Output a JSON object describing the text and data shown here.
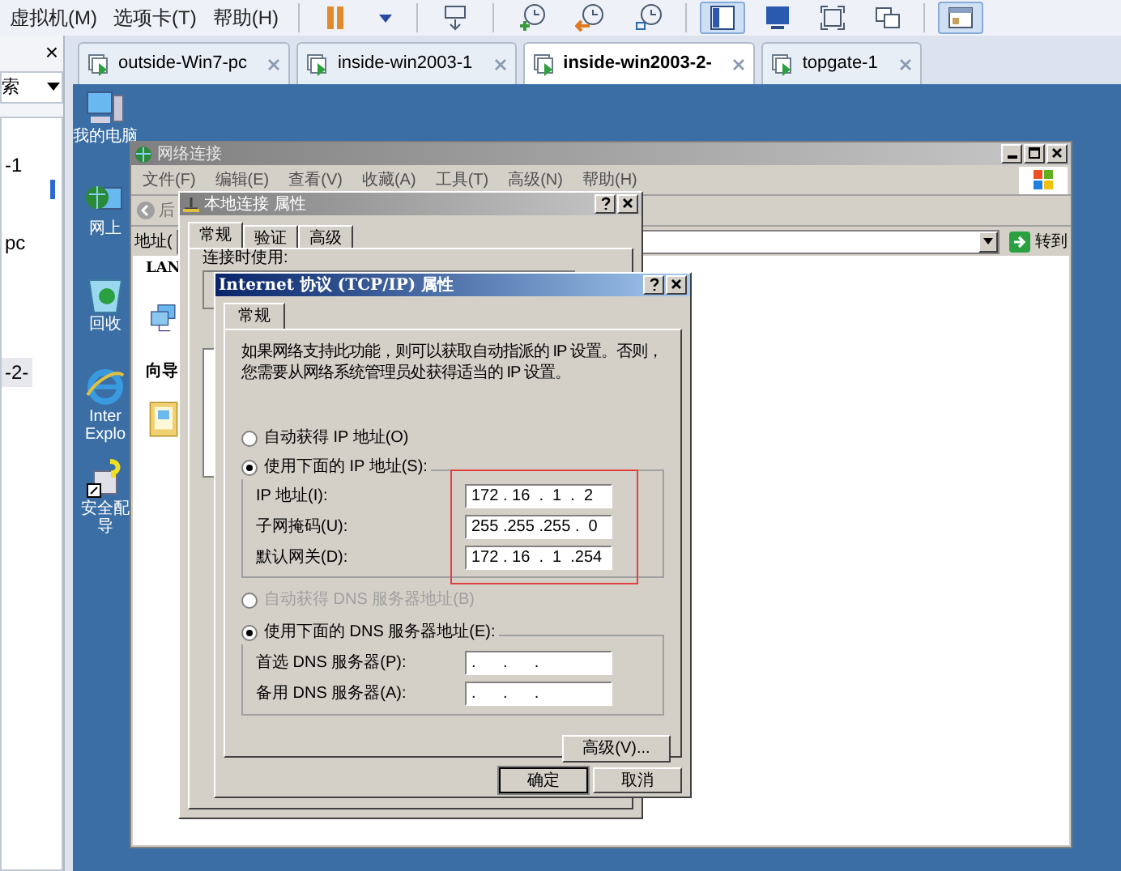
{
  "menubar": [
    "虚拟机(M)",
    "选项卡(T)",
    "帮助(H)"
  ],
  "toolbar": [
    {
      "kind": "separator"
    },
    {
      "kind": "pause",
      "selected": false
    },
    {
      "kind": "dropdown",
      "selected": false
    },
    {
      "kind": "separator"
    },
    {
      "kind": "sendkeys",
      "selected": false
    },
    {
      "kind": "separator"
    },
    {
      "kind": "snapshot",
      "selected": false
    },
    {
      "kind": "revert",
      "selected": false
    },
    {
      "kind": "manager",
      "selected": false
    },
    {
      "kind": "separator"
    },
    {
      "kind": "console",
      "selected": true
    },
    {
      "kind": "fullscreen",
      "selected": false
    },
    {
      "kind": "fit",
      "selected": false
    },
    {
      "kind": "unity",
      "selected": false
    },
    {
      "kind": "separator"
    },
    {
      "kind": "thumbnail",
      "selected": true
    }
  ],
  "library": {
    "close": "×",
    "search": "索",
    "items": [
      {
        "label": "-1",
        "selected": false
      },
      {
        "label": "pc",
        "selected": false
      },
      {
        "label": "-2-",
        "selected": true
      }
    ]
  },
  "vm_tabs": [
    {
      "label": "outside-Win7-pc",
      "selected": false
    },
    {
      "label": "inside-win2003-1",
      "selected": false
    },
    {
      "label": "inside-win2003-2-",
      "selected": true
    },
    {
      "label": "topgate-1",
      "selected": false
    }
  ],
  "desktop_icons": [
    {
      "kind": "computer",
      "lines": [
        "我的电脑"
      ]
    },
    {
      "kind": "network",
      "lines": [
        "网上"
      ]
    },
    {
      "kind": "recycle",
      "lines": [
        "回收"
      ]
    },
    {
      "kind": "browser",
      "lines": [
        "Inter",
        "Explo"
      ]
    },
    {
      "kind": "security",
      "lines": [
        "安全配",
        "导"
      ]
    }
  ],
  "network_window": {
    "title": "网络连接",
    "menu": [
      "文件(F)",
      "编辑(E)",
      "查看(V)",
      "收藏(A)",
      "工具(T)",
      "高级(N)",
      "帮助(H)"
    ],
    "back": "后",
    "address_label": "地址(",
    "go": "转到",
    "sections": [
      "LAN",
      "向导"
    ]
  },
  "local_dialog": {
    "title": "本地连接 属性",
    "tabs": [
      {
        "label": "常规",
        "selected": true
      },
      {
        "label": "验证",
        "selected": false
      },
      {
        "label": "高级",
        "selected": false
      }
    ],
    "connect_using": "连接时使用:"
  },
  "tcp_dialog": {
    "title": "Internet 协议 (TCP/IP) 属性",
    "tab": "常规",
    "intro": [
      "如果网络支持此功能，则可以获取自动指派的 IP 设置。否则，",
      "您需要从网络系统管理员处获得适当的 IP 设置。"
    ],
    "ip_modes": [
      {
        "label": "自动获得 IP 地址(O)",
        "selected": false
      },
      {
        "label": "使用下面的 IP 地址(S):",
        "selected": true
      }
    ],
    "ip_fields": [
      {
        "label": "IP 地址(I):",
        "value": "172 . 16  .  1  .  2"
      },
      {
        "label": "子网掩码(U):",
        "value": "255 .255 .255 .  0"
      },
      {
        "label": "默认网关(D):",
        "value": "172 . 16  .  1  .254"
      }
    ],
    "ip_highlighted": true,
    "dns_modes": [
      {
        "label": "自动获得 DNS 服务器地址(B)",
        "selected": false,
        "disabled": true
      },
      {
        "label": "使用下面的 DNS 服务器地址(E):",
        "selected": true,
        "disabled": false
      }
    ],
    "dns_fields": [
      {
        "label": "首选 DNS 服务器(P):",
        "value": ".      .      ."
      },
      {
        "label": "备用 DNS 服务器(A):",
        "value": ".      .      ."
      }
    ],
    "advanced": "高级(V)...",
    "ok": "确定",
    "cancel": "取消"
  }
}
